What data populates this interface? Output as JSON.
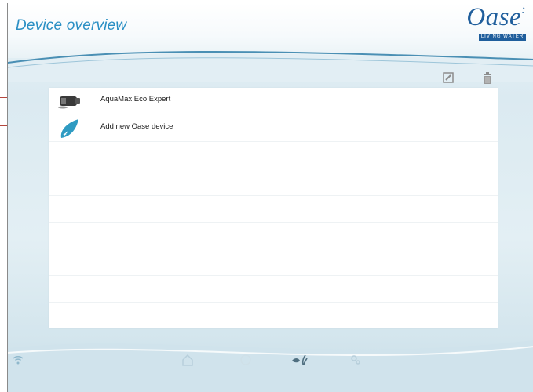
{
  "header": {
    "title": "Device overview",
    "logo_text": "Oase",
    "logo_tagline": "LIVING WATER"
  },
  "toolbar": {
    "edit_icon": "edit-icon",
    "delete_icon": "trash-icon"
  },
  "devices": [
    {
      "name": "AquaMax Eco Expert",
      "icon": "pump-icon"
    },
    {
      "name": "Add new Oase device",
      "icon": "add-device-drop-icon"
    }
  ],
  "bottom_nav": {
    "items": [
      "wifi-icon",
      "home-icon",
      "circle-icon",
      "fish-plant-icon",
      "settings-icon"
    ]
  },
  "colors": {
    "title": "#2a8fc4",
    "logo": "#1f5e9c",
    "callout": "#b4463d",
    "background": "#dbeaf1"
  }
}
